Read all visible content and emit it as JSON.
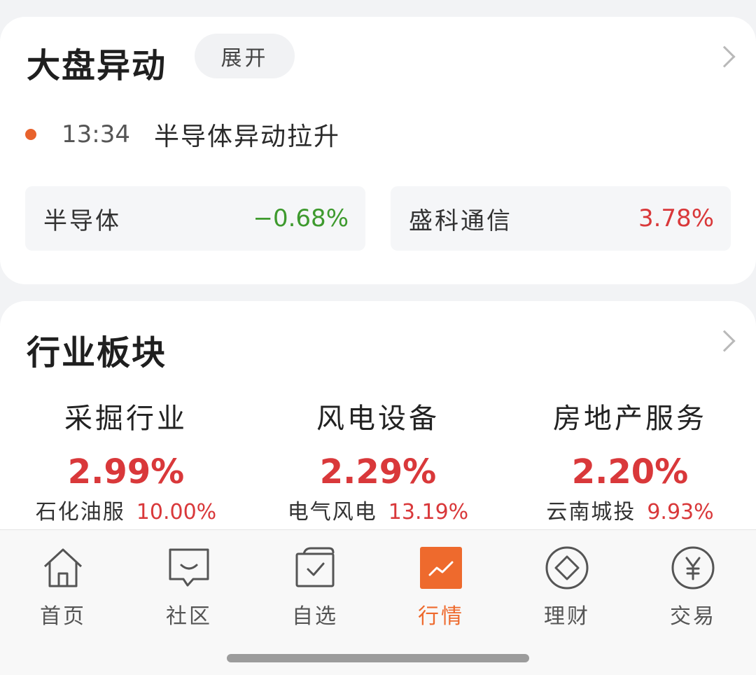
{
  "market_alert": {
    "title": "大盘异动",
    "expand_label": "展开",
    "alert": {
      "time": "13:34",
      "text": "半导体异动拉升"
    },
    "stocks": [
      {
        "name": "半导体",
        "change": "−0.68%",
        "trend": "down"
      },
      {
        "name": "盛科通信",
        "change": "3.78%",
        "trend": "up"
      }
    ]
  },
  "industry": {
    "title": "行业板块",
    "sectors": [
      {
        "name": "采掘行业",
        "change": "2.99%",
        "sub_name": "石化油服",
        "sub_change": "10.00%"
      },
      {
        "name": "风电设备",
        "change": "2.29%",
        "sub_name": "电气风电",
        "sub_change": "13.19%"
      },
      {
        "name": "房地产服务",
        "change": "2.20%",
        "sub_name": "云南城投",
        "sub_change": "9.93%"
      }
    ]
  },
  "nav": {
    "items": [
      {
        "label": "首页",
        "icon": "home-icon"
      },
      {
        "label": "社区",
        "icon": "chat-icon"
      },
      {
        "label": "自选",
        "icon": "watchlist-icon"
      },
      {
        "label": "行情",
        "icon": "market-chart-icon",
        "active": true
      },
      {
        "label": "理财",
        "icon": "wealth-diamond-icon"
      },
      {
        "label": "交易",
        "icon": "yuan-icon"
      }
    ]
  },
  "colors": {
    "accent": "#ee6a2d",
    "up": "#d9383a",
    "down": "#3e9a2e"
  }
}
